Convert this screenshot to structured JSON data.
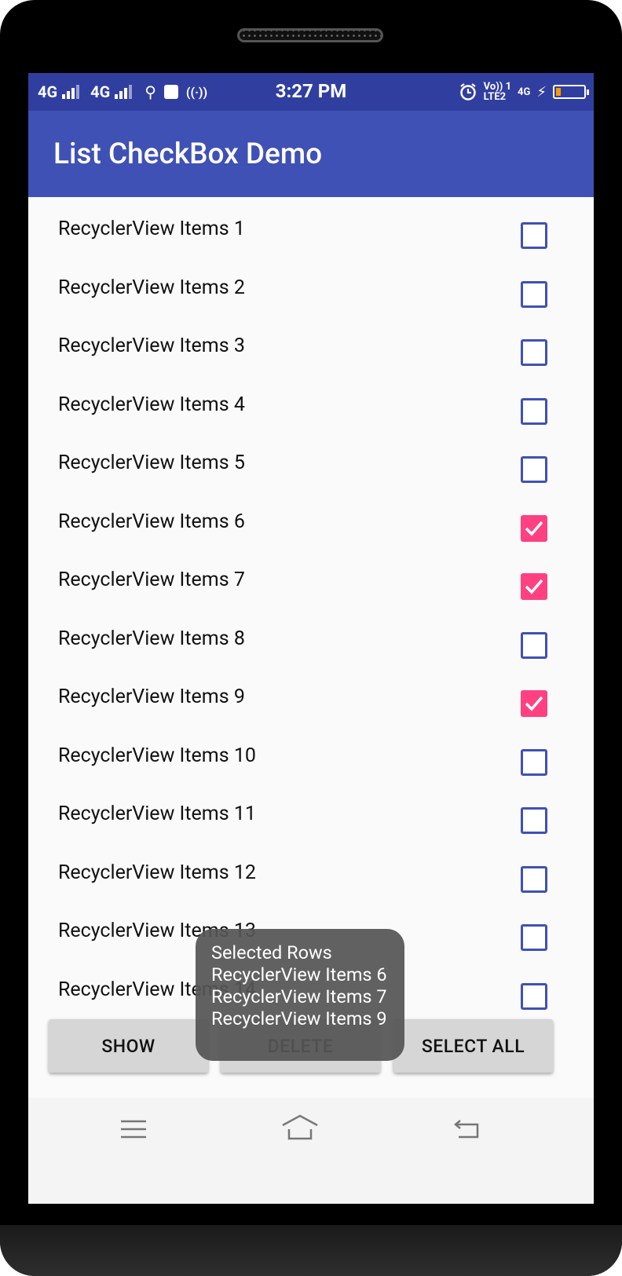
{
  "status_bar": {
    "network_1": "4G",
    "network_2": "4G",
    "time": "3:27 PM",
    "volte_top": "Vo)) 1",
    "volte_bottom": "LTE2",
    "network_right": "4G",
    "battery_level_percent": 10
  },
  "app_bar": {
    "title": "List CheckBox Demo"
  },
  "list": {
    "items": [
      {
        "label": "RecyclerView Items 1",
        "checked": false
      },
      {
        "label": "RecyclerView Items 2",
        "checked": false
      },
      {
        "label": "RecyclerView Items 3",
        "checked": false
      },
      {
        "label": "RecyclerView Items 4",
        "checked": false
      },
      {
        "label": "RecyclerView Items 5",
        "checked": false
      },
      {
        "label": "RecyclerView Items 6",
        "checked": true
      },
      {
        "label": "RecyclerView Items 7",
        "checked": true
      },
      {
        "label": "RecyclerView Items 8",
        "checked": false
      },
      {
        "label": "RecyclerView Items 9",
        "checked": true
      },
      {
        "label": "RecyclerView Items 10",
        "checked": false
      },
      {
        "label": "RecyclerView Items 11",
        "checked": false
      },
      {
        "label": "RecyclerView Items 12",
        "checked": false
      },
      {
        "label": "RecyclerView Items 13",
        "checked": false
      },
      {
        "label": "RecyclerView Items 14",
        "checked": false
      }
    ]
  },
  "buttons": {
    "show": "SHOW",
    "delete": "DELETE",
    "select_all": "SELECT ALL"
  },
  "toast": {
    "lines": [
      "Selected Rows",
      "RecyclerView Items 6",
      "RecyclerView Items 7",
      "RecyclerView Items 9"
    ]
  },
  "colors": {
    "status_bar": "#303f9f",
    "app_bar": "#3f51b5",
    "checkbox_checked": "#ff4081"
  },
  "nav_bar": {
    "icons": [
      "menu-icon",
      "home-icon",
      "back-icon"
    ]
  }
}
